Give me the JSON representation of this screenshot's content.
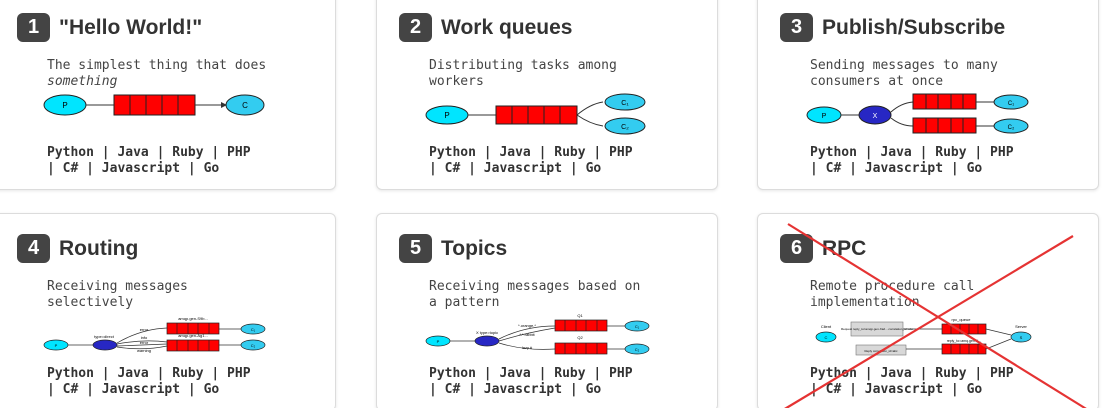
{
  "tutorials": [
    {
      "number": "1",
      "title": "\"Hello World!\"",
      "desc_line1": "The simplest thing that does",
      "desc_line2": "something",
      "diagram": {
        "p": "P",
        "c": "C"
      },
      "langs": [
        "Python",
        "Java",
        "Ruby",
        "PHP",
        "C#",
        "Javascript",
        "Go"
      ]
    },
    {
      "number": "2",
      "title": "Work queues",
      "desc_line1": "Distributing tasks among",
      "desc_line2": "workers",
      "diagram": {
        "p": "P",
        "c1": "C₁",
        "c2": "C₂"
      },
      "langs": [
        "Python",
        "Java",
        "Ruby",
        "PHP",
        "C#",
        "Javascript",
        "Go"
      ]
    },
    {
      "number": "3",
      "title": "Publish/Subscribe",
      "desc_line1": "Sending messages to many",
      "desc_line2": "consumers at once",
      "diagram": {
        "p": "P",
        "x": "X",
        "c1": "C₁",
        "c2": "C₂"
      },
      "langs": [
        "Python",
        "Java",
        "Ruby",
        "PHP",
        "C#",
        "Javascript",
        "Go"
      ]
    },
    {
      "number": "4",
      "title": "Routing",
      "desc_line1": "Receiving messages",
      "desc_line2": "selectively",
      "diagram": {
        "p": "P",
        "x": "type=direct",
        "q1": "amqp.gen-S9b...",
        "q2": "amqp.gen-Ag1...",
        "k1": "error",
        "k2": "info",
        "k3": "error",
        "k4": "warning",
        "c1": "C₁",
        "c2": "C₂"
      },
      "langs": [
        "Python",
        "Java",
        "Ruby",
        "PHP",
        "C#",
        "Javascript",
        "Go"
      ]
    },
    {
      "number": "5",
      "title": "Topics",
      "desc_line1": "Receiving messages based on",
      "desc_line2": "a pattern",
      "diagram": {
        "p": "P",
        "x": "X type=topic",
        "q1": "Q1",
        "q2": "Q2",
        "k1": "*.orange.*",
        "k2": "*.*.rabbit",
        "k3": "lazy.#",
        "c1": "C₁",
        "c2": "C₂"
      },
      "langs": [
        "Python",
        "Java",
        "Ruby",
        "PHP",
        "C#",
        "Javascript",
        "Go"
      ]
    },
    {
      "number": "6",
      "title": "RPC",
      "desc_line1": "Remote procedure call",
      "desc_line2": "implementation",
      "diagram": {
        "client": "Client",
        "server": "Server",
        "c": "C",
        "s": "S",
        "rpc_queue": "rpc_queue",
        "reply": "reply_to=amq.gen-X...",
        "req": "Request reply_to=amqp.gen-Xa2... correlation_id=abc",
        "rep": "Reply correlation_id=abc"
      },
      "langs": [
        "Python",
        "Java",
        "Ruby",
        "PHP",
        "C#",
        "Javascript",
        "Go"
      ]
    }
  ],
  "colors": {
    "queue": "#ff0000",
    "producer": "#00e5ff",
    "consumer": "#33ccf0",
    "exchange": "#2727c4",
    "cross": "#e53333",
    "badge": "#444444"
  }
}
